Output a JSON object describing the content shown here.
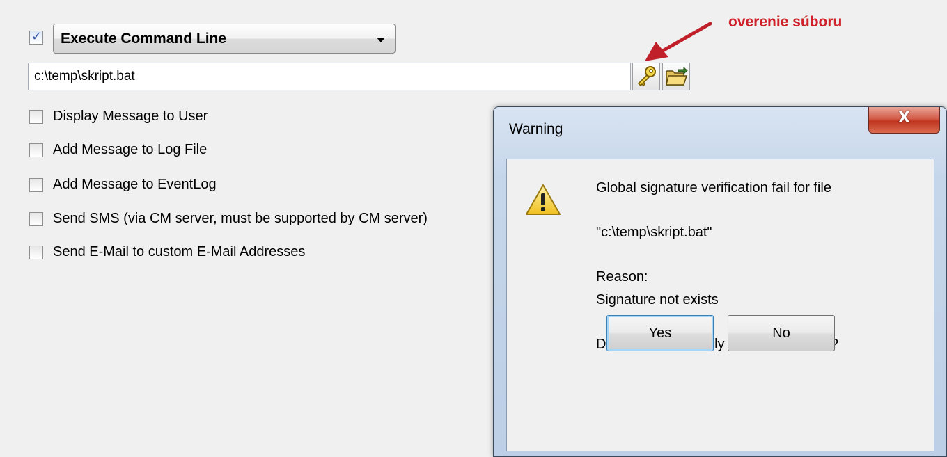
{
  "action": {
    "enabled": true,
    "type_selected": "Execute Command Line",
    "command_path": "c:\\temp\\skript.bat"
  },
  "options": [
    {
      "label": "Display Message to User",
      "checked": false
    },
    {
      "label": "Add Message to Log File",
      "checked": false
    },
    {
      "label": "Add Message to EventLog",
      "checked": false
    },
    {
      "label": "Send SMS (via CM server, must be supported by CM server)",
      "checked": false
    },
    {
      "label": "Send E-Mail to custom E-Mail Addresses",
      "checked": false
    }
  ],
  "icons": {
    "verify": "key-icon",
    "browse": "open-folder-icon",
    "warning": "warning-icon",
    "close": "close-icon"
  },
  "annotation": {
    "text": "overenie súboru",
    "color": "#d0202a"
  },
  "dialog": {
    "title": "Warning",
    "line1": "Global signature verification fail for file",
    "file": "\"c:\\temp\\skript.bat\"",
    "reason_label": "Reason:",
    "reason": "Signature not exists",
    "question": "Do you want globally sign this file now?",
    "yes_label": "Yes",
    "no_label": "No",
    "close_glyph": "X"
  }
}
